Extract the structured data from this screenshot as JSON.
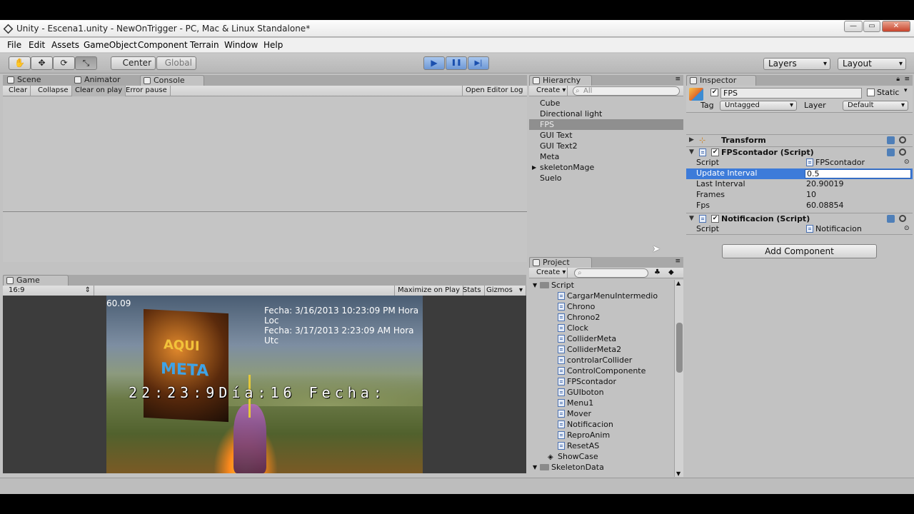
{
  "window": {
    "title": "Unity - Escena1.unity - NewOnTrigger - PC, Mac & Linux Standalone*",
    "minimize": "—",
    "maximize": "▭",
    "close": "✕"
  },
  "menu": [
    "File",
    "Edit",
    "Assets",
    "GameObject",
    "Component",
    "Terrain",
    "Window",
    "Help"
  ],
  "toolbar": {
    "tools": [
      "hand-icon",
      "move-icon",
      "rotate-icon",
      "scale-icon"
    ],
    "pivot": "Center",
    "space": "Global",
    "play": "▶",
    "pause": "❚❚",
    "step": "▶|",
    "layers": "Layers",
    "layout": "Layout"
  },
  "console": {
    "tabs": [
      "Scene",
      "Animator",
      "Console"
    ],
    "buttons": [
      "Clear",
      "Collapse",
      "Clear on play",
      "Error pause"
    ],
    "open_log": "Open Editor Log"
  },
  "game": {
    "tab": "Game",
    "aspect": "16:9",
    "buttons": [
      "Maximize on Play",
      "Stats",
      "Gizmos"
    ],
    "fps_label": "60.09",
    "fecha1": "Fecha: 3/16/2013 10:23:09 PM Hora Loc",
    "fecha2": "Fecha: 3/17/2013 2:23:09 AM Hora Utc",
    "clock_text": "22:23:9Día:16 Fecha:",
    "sign_top": "AQUI",
    "sign_bottom": "META"
  },
  "hierarchy": {
    "tab": "Hierarchy",
    "create": "Create",
    "search_placeholder": "All",
    "items": [
      "Cube",
      "Directional light",
      "FPS",
      "GUI Text",
      "GUI Text2",
      "Meta",
      "skeletonMage",
      "Suelo"
    ],
    "selected": "FPS"
  },
  "project": {
    "tab": "Project",
    "create": "Create",
    "folder_script": "Script",
    "scripts": [
      "CargarMenuIntermedio",
      "Chrono",
      "Chrono2",
      "Clock",
      "ColliderMeta",
      "ColliderMeta2",
      "controlarCollider",
      "ControlComponente",
      "FPScontador",
      "GUIboton",
      "Menu1",
      "Mover",
      "Notificacion",
      "ReproAnim",
      "ResetAS"
    ],
    "showcase": "ShowCase",
    "skeleton_data": "SkeletonData"
  },
  "inspector": {
    "tab": "Inspector",
    "name": "FPS",
    "static_label": "Static",
    "tag_label": "Tag",
    "tag_value": "Untagged",
    "layer_label": "Layer",
    "layer_value": "Default",
    "transform": "Transform",
    "fps_component": "FPScontador (Script)",
    "fps_props": [
      {
        "label": "Script",
        "value": "FPScontador"
      },
      {
        "label": "Update Interval",
        "value": "0.5"
      },
      {
        "label": "Last Interval",
        "value": "20.90019"
      },
      {
        "label": "Frames",
        "value": "10"
      },
      {
        "label": "Fps",
        "value": "60.08854"
      }
    ],
    "notif_component": "Notificacion (Script)",
    "notif_script_label": "Script",
    "notif_script_value": "Notificacion",
    "add_component": "Add Component"
  }
}
